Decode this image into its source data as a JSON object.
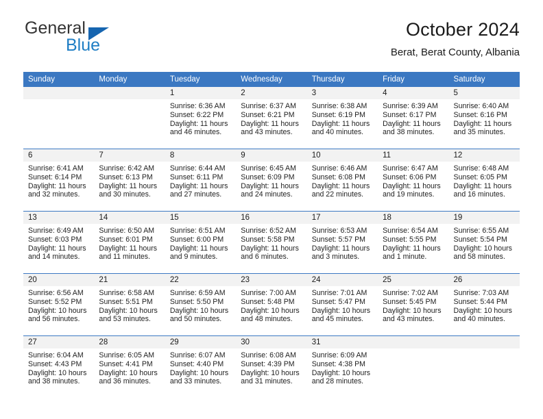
{
  "brand": {
    "name_part1": "General",
    "name_part2": "Blue",
    "flag_icon": "blue-triangle-flag-icon",
    "color_dark": "#333333",
    "color_blue": "#1f7ec4"
  },
  "header": {
    "title": "October 2024",
    "subtitle": "Berat, Berat County, Albania"
  },
  "theme": {
    "header_blue": "#3b78c2",
    "daynum_band": "#f2f2f2",
    "text": "#1a1a1a"
  },
  "weekday_headers": [
    "Sunday",
    "Monday",
    "Tuesday",
    "Wednesday",
    "Thursday",
    "Friday",
    "Saturday"
  ],
  "weeks": [
    [
      {
        "day": "",
        "sunrise": "",
        "sunset": "",
        "daylight": ""
      },
      {
        "day": "",
        "sunrise": "",
        "sunset": "",
        "daylight": ""
      },
      {
        "day": "1",
        "sunrise": "Sunrise: 6:36 AM",
        "sunset": "Sunset: 6:22 PM",
        "daylight": "Daylight: 11 hours and 46 minutes."
      },
      {
        "day": "2",
        "sunrise": "Sunrise: 6:37 AM",
        "sunset": "Sunset: 6:21 PM",
        "daylight": "Daylight: 11 hours and 43 minutes."
      },
      {
        "day": "3",
        "sunrise": "Sunrise: 6:38 AM",
        "sunset": "Sunset: 6:19 PM",
        "daylight": "Daylight: 11 hours and 40 minutes."
      },
      {
        "day": "4",
        "sunrise": "Sunrise: 6:39 AM",
        "sunset": "Sunset: 6:17 PM",
        "daylight": "Daylight: 11 hours and 38 minutes."
      },
      {
        "day": "5",
        "sunrise": "Sunrise: 6:40 AM",
        "sunset": "Sunset: 6:16 PM",
        "daylight": "Daylight: 11 hours and 35 minutes."
      }
    ],
    [
      {
        "day": "6",
        "sunrise": "Sunrise: 6:41 AM",
        "sunset": "Sunset: 6:14 PM",
        "daylight": "Daylight: 11 hours and 32 minutes."
      },
      {
        "day": "7",
        "sunrise": "Sunrise: 6:42 AM",
        "sunset": "Sunset: 6:13 PM",
        "daylight": "Daylight: 11 hours and 30 minutes."
      },
      {
        "day": "8",
        "sunrise": "Sunrise: 6:44 AM",
        "sunset": "Sunset: 6:11 PM",
        "daylight": "Daylight: 11 hours and 27 minutes."
      },
      {
        "day": "9",
        "sunrise": "Sunrise: 6:45 AM",
        "sunset": "Sunset: 6:09 PM",
        "daylight": "Daylight: 11 hours and 24 minutes."
      },
      {
        "day": "10",
        "sunrise": "Sunrise: 6:46 AM",
        "sunset": "Sunset: 6:08 PM",
        "daylight": "Daylight: 11 hours and 22 minutes."
      },
      {
        "day": "11",
        "sunrise": "Sunrise: 6:47 AM",
        "sunset": "Sunset: 6:06 PM",
        "daylight": "Daylight: 11 hours and 19 minutes."
      },
      {
        "day": "12",
        "sunrise": "Sunrise: 6:48 AM",
        "sunset": "Sunset: 6:05 PM",
        "daylight": "Daylight: 11 hours and 16 minutes."
      }
    ],
    [
      {
        "day": "13",
        "sunrise": "Sunrise: 6:49 AM",
        "sunset": "Sunset: 6:03 PM",
        "daylight": "Daylight: 11 hours and 14 minutes."
      },
      {
        "day": "14",
        "sunrise": "Sunrise: 6:50 AM",
        "sunset": "Sunset: 6:01 PM",
        "daylight": "Daylight: 11 hours and 11 minutes."
      },
      {
        "day": "15",
        "sunrise": "Sunrise: 6:51 AM",
        "sunset": "Sunset: 6:00 PM",
        "daylight": "Daylight: 11 hours and 9 minutes."
      },
      {
        "day": "16",
        "sunrise": "Sunrise: 6:52 AM",
        "sunset": "Sunset: 5:58 PM",
        "daylight": "Daylight: 11 hours and 6 minutes."
      },
      {
        "day": "17",
        "sunrise": "Sunrise: 6:53 AM",
        "sunset": "Sunset: 5:57 PM",
        "daylight": "Daylight: 11 hours and 3 minutes."
      },
      {
        "day": "18",
        "sunrise": "Sunrise: 6:54 AM",
        "sunset": "Sunset: 5:55 PM",
        "daylight": "Daylight: 11 hours and 1 minute."
      },
      {
        "day": "19",
        "sunrise": "Sunrise: 6:55 AM",
        "sunset": "Sunset: 5:54 PM",
        "daylight": "Daylight: 10 hours and 58 minutes."
      }
    ],
    [
      {
        "day": "20",
        "sunrise": "Sunrise: 6:56 AM",
        "sunset": "Sunset: 5:52 PM",
        "daylight": "Daylight: 10 hours and 56 minutes."
      },
      {
        "day": "21",
        "sunrise": "Sunrise: 6:58 AM",
        "sunset": "Sunset: 5:51 PM",
        "daylight": "Daylight: 10 hours and 53 minutes."
      },
      {
        "day": "22",
        "sunrise": "Sunrise: 6:59 AM",
        "sunset": "Sunset: 5:50 PM",
        "daylight": "Daylight: 10 hours and 50 minutes."
      },
      {
        "day": "23",
        "sunrise": "Sunrise: 7:00 AM",
        "sunset": "Sunset: 5:48 PM",
        "daylight": "Daylight: 10 hours and 48 minutes."
      },
      {
        "day": "24",
        "sunrise": "Sunrise: 7:01 AM",
        "sunset": "Sunset: 5:47 PM",
        "daylight": "Daylight: 10 hours and 45 minutes."
      },
      {
        "day": "25",
        "sunrise": "Sunrise: 7:02 AM",
        "sunset": "Sunset: 5:45 PM",
        "daylight": "Daylight: 10 hours and 43 minutes."
      },
      {
        "day": "26",
        "sunrise": "Sunrise: 7:03 AM",
        "sunset": "Sunset: 5:44 PM",
        "daylight": "Daylight: 10 hours and 40 minutes."
      }
    ],
    [
      {
        "day": "27",
        "sunrise": "Sunrise: 6:04 AM",
        "sunset": "Sunset: 4:43 PM",
        "daylight": "Daylight: 10 hours and 38 minutes."
      },
      {
        "day": "28",
        "sunrise": "Sunrise: 6:05 AM",
        "sunset": "Sunset: 4:41 PM",
        "daylight": "Daylight: 10 hours and 36 minutes."
      },
      {
        "day": "29",
        "sunrise": "Sunrise: 6:07 AM",
        "sunset": "Sunset: 4:40 PM",
        "daylight": "Daylight: 10 hours and 33 minutes."
      },
      {
        "day": "30",
        "sunrise": "Sunrise: 6:08 AM",
        "sunset": "Sunset: 4:39 PM",
        "daylight": "Daylight: 10 hours and 31 minutes."
      },
      {
        "day": "31",
        "sunrise": "Sunrise: 6:09 AM",
        "sunset": "Sunset: 4:38 PM",
        "daylight": "Daylight: 10 hours and 28 minutes."
      },
      {
        "day": "",
        "sunrise": "",
        "sunset": "",
        "daylight": ""
      },
      {
        "day": "",
        "sunrise": "",
        "sunset": "",
        "daylight": ""
      }
    ]
  ]
}
